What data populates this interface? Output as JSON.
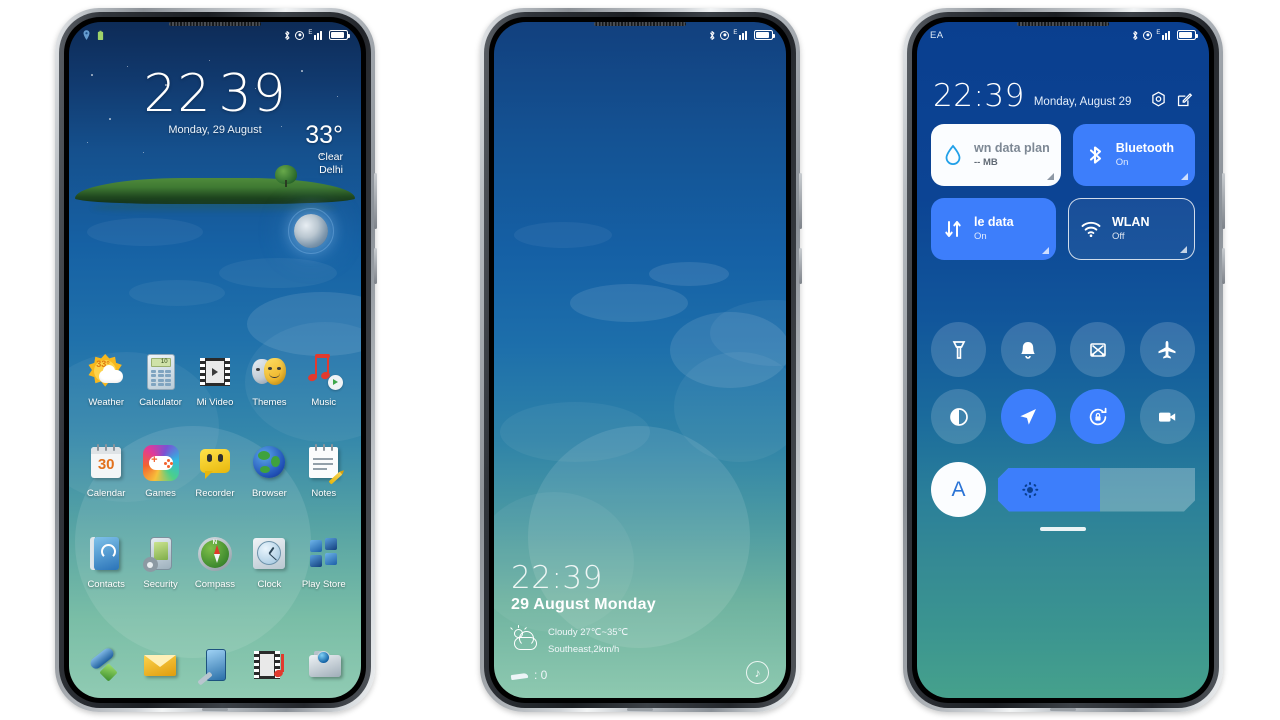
{
  "phone1": {
    "statusbar": {
      "left_icons": [
        "location-notification-icon",
        "battery-saver-notification-icon"
      ],
      "right_icons": [
        "bluetooth-icon",
        "do-not-disturb-icon",
        "signal-e-icon",
        "battery-icon"
      ],
      "network_type": "E"
    },
    "lockscreen": {
      "time_hours": "22",
      "time_minutes": "39",
      "date": "Monday, 29 August",
      "temperature": "33°",
      "condition": "Clear",
      "city": "Delhi"
    },
    "apps_row1": [
      {
        "label": "Weather",
        "icon": "weather-icon"
      },
      {
        "label": "Calculator",
        "icon": "calculator-icon"
      },
      {
        "label": "Mi Video",
        "icon": "mi-video-icon"
      },
      {
        "label": "Themes",
        "icon": "themes-icon"
      },
      {
        "label": "Music",
        "icon": "music-icon"
      }
    ],
    "apps_row2": [
      {
        "label": "Calendar",
        "icon": "calendar-icon",
        "badge": "30"
      },
      {
        "label": "Games",
        "icon": "games-icon"
      },
      {
        "label": "Recorder",
        "icon": "recorder-icon"
      },
      {
        "label": "Browser",
        "icon": "browser-icon"
      },
      {
        "label": "Notes",
        "icon": "notes-icon"
      }
    ],
    "apps_row3": [
      {
        "label": "Contacts",
        "icon": "contacts-icon"
      },
      {
        "label": "Security",
        "icon": "security-icon"
      },
      {
        "label": "Compass",
        "icon": "compass-icon",
        "north": "N"
      },
      {
        "label": "Clock",
        "icon": "clock-icon"
      },
      {
        "label": "Play Store",
        "icon": "play-store-icon"
      }
    ],
    "dock": [
      {
        "icon": "phone-dialer-icon"
      },
      {
        "icon": "messaging-icon"
      },
      {
        "icon": "tools-icon"
      },
      {
        "icon": "video-icon"
      },
      {
        "icon": "camera-icon"
      }
    ],
    "calculator_display": "10"
  },
  "phone2": {
    "statusbar": {
      "right_icons": [
        "bluetooth-icon",
        "do-not-disturb-icon",
        "signal-e-icon",
        "battery-icon"
      ],
      "network_type": "E"
    },
    "widget": {
      "time": "22:39",
      "date": "29 August Monday",
      "weather_line": "Cloudy 27℃~35℃",
      "wind_line": "Southeast,2km/h",
      "steps_label": ": 0",
      "music_glyph": "♪"
    }
  },
  "phone3": {
    "statusbar": {
      "carrier": "EA",
      "right_icons": [
        "bluetooth-icon",
        "do-not-disturb-icon",
        "signal-e-icon",
        "battery-icon"
      ],
      "network_type": "E"
    },
    "header": {
      "time": "22:39",
      "date": "Monday, August 29",
      "settings_icon": "gear-icon",
      "edit_icon": "edit-icon"
    },
    "cards": [
      {
        "title": "wn data plan",
        "sub": "-- MB",
        "state": "white",
        "icon": "data-drop-icon"
      },
      {
        "title": "Bluetooth",
        "sub": "On",
        "state": "blue",
        "icon": "bluetooth-icon"
      },
      {
        "title": "le data",
        "sub": "On",
        "state": "blue",
        "icon": "mobile-data-icon"
      },
      {
        "title": "WLAN",
        "sub": "Off",
        "state": "off",
        "icon": "wifi-icon"
      }
    ],
    "toggles_row1": [
      {
        "name": "flashlight-icon",
        "active": false
      },
      {
        "name": "ringer-bell-icon",
        "active": false
      },
      {
        "name": "screenshot-icon",
        "active": false
      },
      {
        "name": "airplane-mode-icon",
        "active": false
      }
    ],
    "toggles_row2": [
      {
        "name": "dark-mode-icon",
        "active": false
      },
      {
        "name": "location-icon",
        "active": true
      },
      {
        "name": "rotation-lock-icon",
        "active": true
      },
      {
        "name": "screen-record-icon",
        "active": false
      }
    ],
    "brightness": {
      "auto_label": "A",
      "level_percent": 52,
      "sun_icon": "brightness-sun-icon"
    }
  },
  "colors": {
    "accent_blue": "#3d7efb",
    "card_white": "#fbfdff",
    "wall_top": "#0a3f8f",
    "wall_bottom": "#46a18c"
  }
}
